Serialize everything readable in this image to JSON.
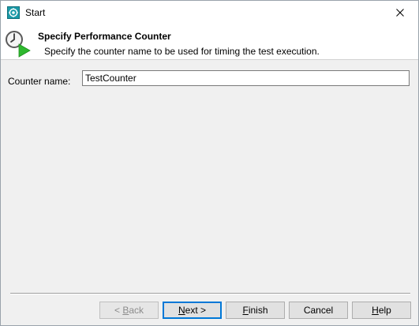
{
  "window": {
    "title": "Start"
  },
  "header": {
    "title": "Specify Performance Counter",
    "description": "Specify the counter name to be used for timing the test execution."
  },
  "form": {
    "counter_name_label": "Counter name:",
    "counter_name_value": "TestCounter"
  },
  "buttons": {
    "back": {
      "mnemonic": "B",
      "rest": "ack",
      "prefix": "< ",
      "enabled": false
    },
    "next": {
      "mnemonic": "N",
      "rest": "ext >",
      "prefix": "",
      "enabled": true
    },
    "finish": {
      "mnemonic": "F",
      "rest": "inish",
      "prefix": "",
      "enabled": true
    },
    "cancel": {
      "label": "Cancel",
      "enabled": true
    },
    "help": {
      "mnemonic": "H",
      "rest": "elp",
      "prefix": "",
      "enabled": true
    }
  },
  "icons": {
    "app": "app-gear-icon",
    "close": "close-icon",
    "header": "clock-play-icon"
  },
  "colors": {
    "window_bg": "#f0f0f0",
    "panel_bg": "#ffffff",
    "play_green": "#2eb82e",
    "app_icon_teal": "#1a9aa8",
    "default_button_border": "#0078d7"
  }
}
